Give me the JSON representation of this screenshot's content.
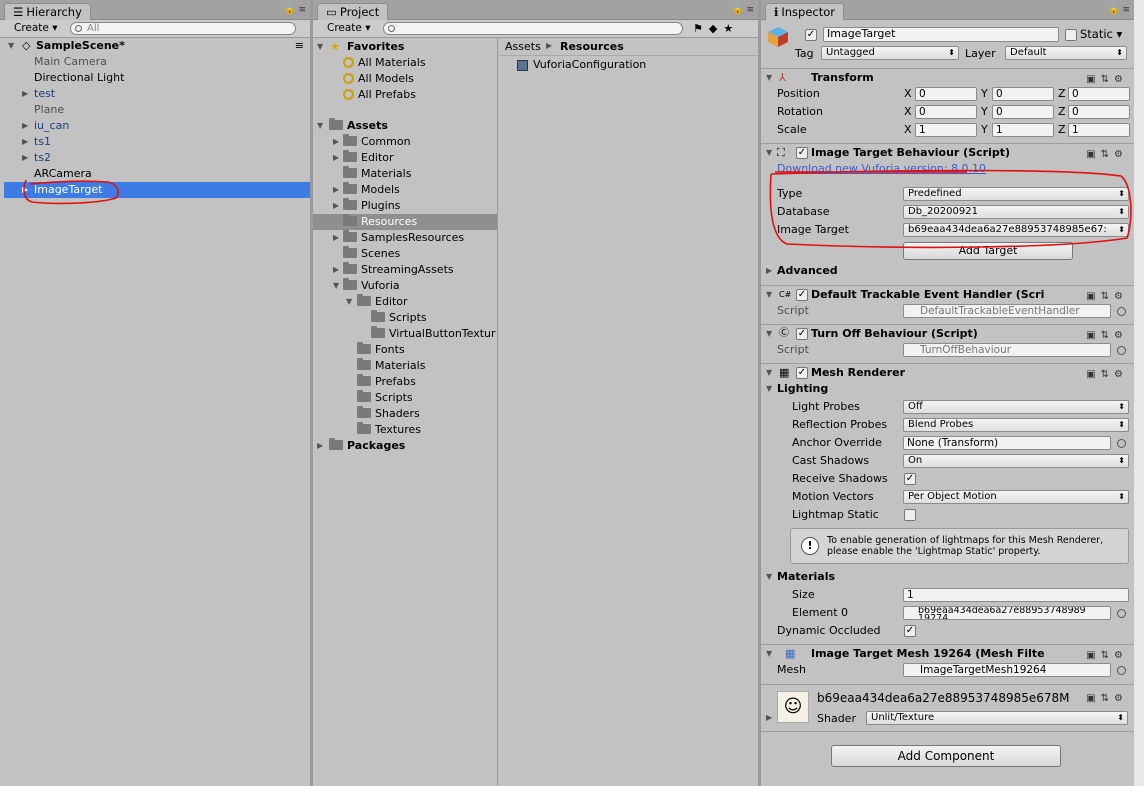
{
  "hierarchy": {
    "tab_label": "Hierarchy",
    "create_label": "Create",
    "search_placeholder": "All",
    "scene_name": "SampleScene*",
    "items": [
      "Main Camera",
      "Directional Light",
      "test",
      "Plane",
      "iu_can",
      "ts1",
      "ts2",
      "ARCamera",
      "ImageTarget"
    ]
  },
  "project": {
    "tab_label": "Project",
    "create_label": "Create",
    "favorites_label": "Favorites",
    "favorites": [
      "All Materials",
      "All Models",
      "All Prefabs"
    ],
    "assets_label": "Assets",
    "folders": [
      "Common",
      "Editor",
      "Materials",
      "Models",
      "Plugins",
      "Resources",
      "SamplesResources",
      "Scenes",
      "StreamingAssets",
      "Vuforia",
      "Editor",
      "Scripts",
      "VirtualButtonTextur",
      "Fonts",
      "Materials",
      "Prefabs",
      "Scripts",
      "Shaders",
      "Textures"
    ],
    "packages_label": "Packages",
    "breadcrumb": [
      "Assets",
      "Resources"
    ],
    "files": [
      "VuforiaConfiguration"
    ]
  },
  "inspector": {
    "tab_label": "Inspector",
    "object_name": "ImageTarget",
    "static_label": "Static",
    "tag_label": "Tag",
    "tag_value": "Untagged",
    "layer_label": "Layer",
    "layer_value": "Default",
    "transform": {
      "title": "Transform",
      "position_label": "Position",
      "rotation_label": "Rotation",
      "scale_label": "Scale",
      "axis": [
        "X",
        "Y",
        "Z"
      ],
      "position": [
        "0",
        "0",
        "0"
      ],
      "rotation": [
        "0",
        "0",
        "0"
      ],
      "scale": [
        "1",
        "1",
        "1"
      ]
    },
    "image_target": {
      "title": "Image Target Behaviour (Script)",
      "download_link": "Download new Vuforia version: 8.0.10",
      "type_label": "Type",
      "type_value": "Predefined",
      "database_label": "Database",
      "database_value": "Db_20200921",
      "target_label": "Image Target",
      "target_value": "b69eaa434dea6a27e88953748985e67:",
      "add_target": "Add Target",
      "advanced": "Advanced"
    },
    "trackable": {
      "title": "Default Trackable Event Handler (Scri",
      "script_label": "Script",
      "script_value": "DefaultTrackableEventHandler"
    },
    "turnoff": {
      "title": "Turn Off Behaviour (Script)",
      "script_label": "Script",
      "script_value": "TurnOffBehaviour"
    },
    "mesh_renderer": {
      "title": "Mesh Renderer",
      "lighting": "Lighting",
      "light_probes_label": "Light Probes",
      "light_probes": "Off",
      "reflection_label": "Reflection Probes",
      "reflection": "Blend Probes",
      "anchor_label": "Anchor Override",
      "anchor": "None (Transform)",
      "cast_label": "Cast Shadows",
      "cast": "On",
      "receive_label": "Receive Shadows",
      "motion_label": "Motion Vectors",
      "motion": "Per Object Motion",
      "lightmap_label": "Lightmap Static",
      "info_line1": "To enable generation of lightmaps for this Mesh Renderer,",
      "info_line2": "please enable the 'Lightmap Static' property.",
      "materials": "Materials",
      "size_label": "Size",
      "size": "1",
      "element_label": "Element 0",
      "element": "b69eaa434dea6a27e88953748989",
      "element_line2": "19274",
      "dynamic_label": "Dynamic Occluded"
    },
    "mesh_filter": {
      "title": "Image Target Mesh 19264 (Mesh Filte",
      "mesh_label": "Mesh",
      "mesh": "ImageTargetMesh19264"
    },
    "material": {
      "name": "b69eaa434dea6a27e88953748985e678M",
      "shader_label": "Shader",
      "shader": "Unlit/Texture"
    },
    "add_component": "Add Component"
  },
  "colors": {
    "selection": "#3e7ce5",
    "annotation": "#e01010",
    "link": "#3b5ccf"
  }
}
